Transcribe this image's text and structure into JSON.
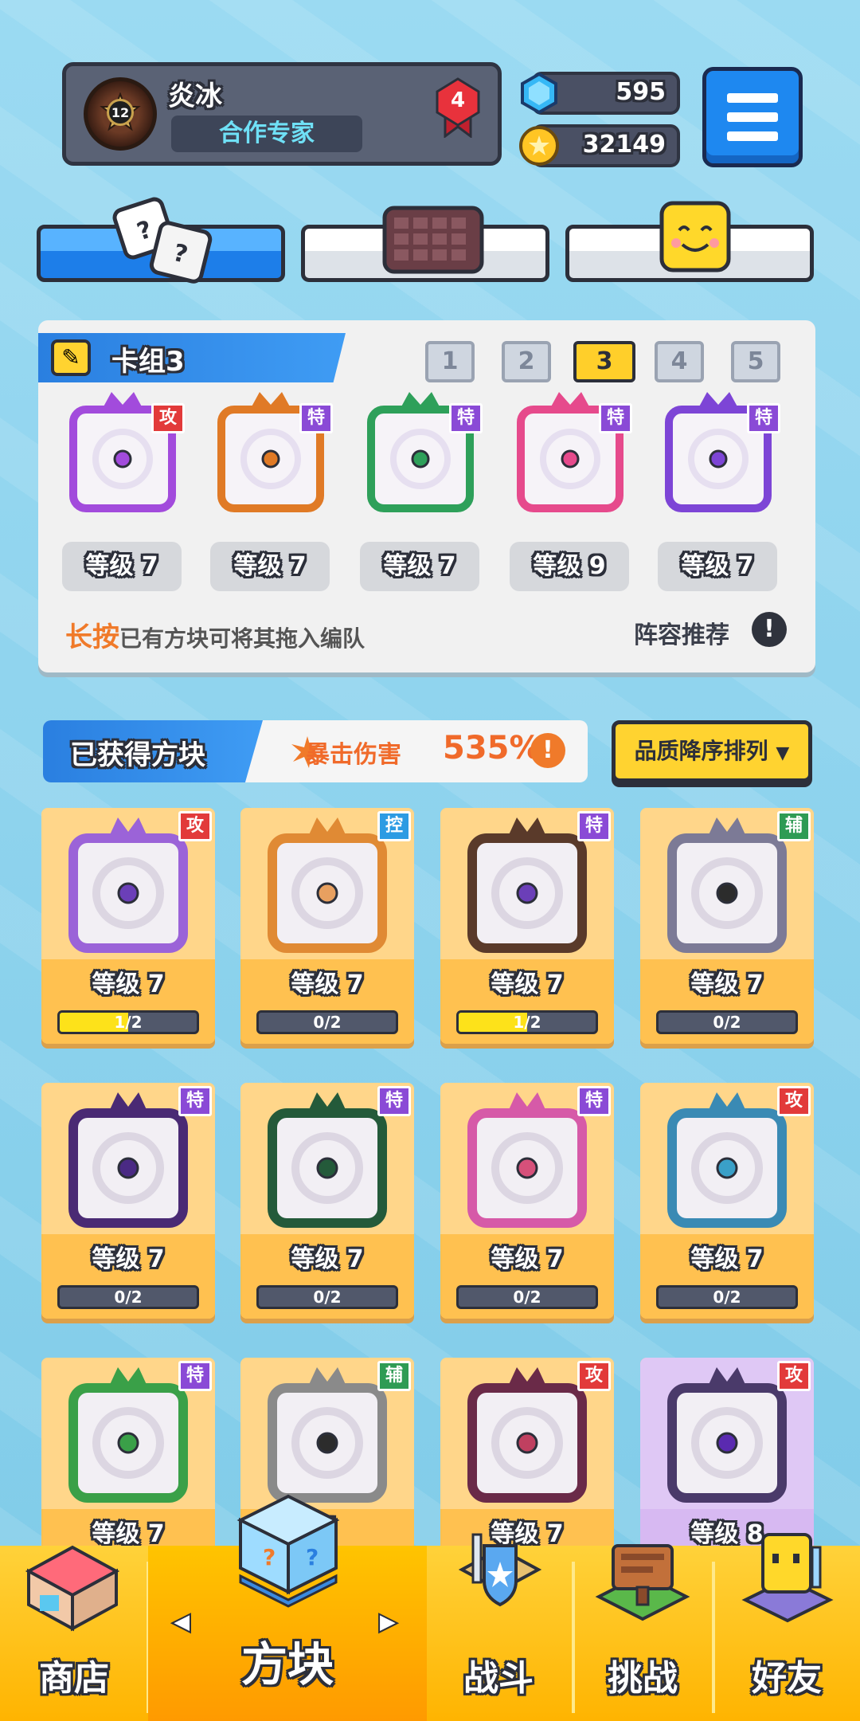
{
  "profile": {
    "name": "炎冰",
    "title": "合作专家",
    "level": "12",
    "rank": "4"
  },
  "resources": {
    "gems": "595",
    "coins": "32149"
  },
  "deck": {
    "title": "卡组3",
    "slots": [
      "1",
      "2",
      "3",
      "4",
      "5"
    ],
    "active_slot": "3",
    "cards": [
      {
        "tag": "攻",
        "level": "等级 7",
        "color": "#a24bdc"
      },
      {
        "tag": "特",
        "level": "等级 7",
        "color": "#e07a26"
      },
      {
        "tag": "特",
        "level": "等级 7",
        "color": "#2ea05a"
      },
      {
        "tag": "特",
        "level": "等级 9",
        "color": "#e64a8c"
      },
      {
        "tag": "特",
        "level": "等级 7",
        "color": "#7d45d6"
      }
    ],
    "hint_highlight": "长按",
    "hint_rest": "已有方块可将其拖入编队",
    "recommend": "阵容推荐",
    "info_mark": "!"
  },
  "owned": {
    "title": "已获得方块",
    "crit_label": "暴击伤害",
    "crit_value": "535%",
    "sort_label": "品质降序排列"
  },
  "blocks": [
    {
      "tag": "攻",
      "tag_color": "#e23a3a",
      "level": "等级 7",
      "progress": "1/2",
      "fill": 0.5,
      "color": "#9b63d8",
      "dot": "#6b3fb8"
    },
    {
      "tag": "控",
      "tag_color": "#2c9be3",
      "level": "等级 7",
      "progress": "0/2",
      "fill": 0,
      "color": "#e08a34",
      "dot": "#e8a060"
    },
    {
      "tag": "特",
      "tag_color": "#8a4ad6",
      "level": "等级 7",
      "progress": "1/2",
      "fill": 0.5,
      "color": "#5a3a2a",
      "dot": "#6b3fb8"
    },
    {
      "tag": "辅",
      "tag_color": "#2e9b54",
      "level": "等级 7",
      "progress": "0/2",
      "fill": 0,
      "color": "#7c7a96",
      "dot": "#2c2c2c"
    },
    {
      "tag": "特",
      "tag_color": "#8a4ad6",
      "level": "等级 7",
      "progress": "0/2",
      "fill": 0,
      "color": "#4a2a74",
      "dot": "#4a2a84"
    },
    {
      "tag": "特",
      "tag_color": "#8a4ad6",
      "level": "等级 7",
      "progress": "0/2",
      "fill": 0,
      "color": "#245a3a",
      "dot": "#245a3a"
    },
    {
      "tag": "特",
      "tag_color": "#8a4ad6",
      "level": "等级 7",
      "progress": "0/2",
      "fill": 0,
      "color": "#d65aa8",
      "dot": "#d6507a"
    },
    {
      "tag": "攻",
      "tag_color": "#e23a3a",
      "level": "等级 7",
      "progress": "0/2",
      "fill": 0,
      "color": "#3a8ab4",
      "dot": "#3aa0c8"
    },
    {
      "tag": "特",
      "tag_color": "#8a4ad6",
      "level": "等级 7",
      "progress": "",
      "fill": 0,
      "color": "#3aa048",
      "dot": "#3aa048"
    },
    {
      "tag": "辅",
      "tag_color": "#2e9b54",
      "level": "7",
      "progress": "",
      "fill": 0,
      "color": "#8a8a8a",
      "dot": "#2c2c2c"
    },
    {
      "tag": "攻",
      "tag_color": "#e23a3a",
      "level": "等级 7",
      "progress": "",
      "fill": 0,
      "color": "#6a2a48",
      "dot": "#c04060"
    },
    {
      "tag": "攻",
      "tag_color": "#e23a3a",
      "level": "等级 8",
      "progress": "",
      "fill": 0,
      "color": "#4a3a6a",
      "dot": "#5a2ab0"
    }
  ],
  "nav": {
    "shop": "商店",
    "blocks": "方块",
    "battle": "战斗",
    "challenge": "挑战",
    "friends": "好友"
  }
}
